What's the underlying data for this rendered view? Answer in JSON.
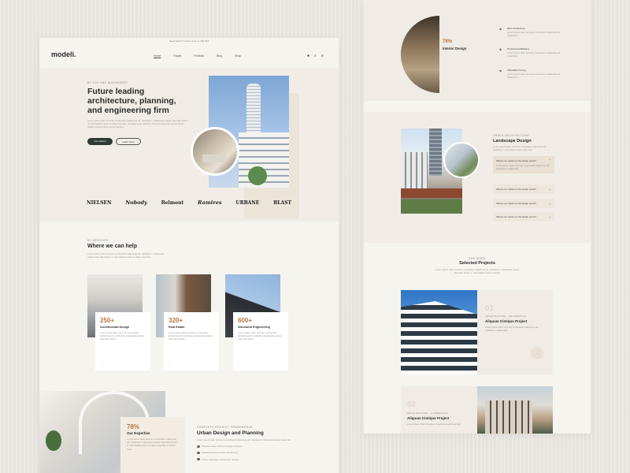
{
  "left": {
    "topbar": "Need Help? Contact us at +1 234 567",
    "logo": "modeli.",
    "nav": [
      "Home",
      "Pages",
      "Portfolio",
      "Blog",
      "Shop"
    ],
    "hero": {
      "overline": "BY YOU AND BUSINESSES",
      "title": "Future leading architecture, planning, and engineering firm",
      "desc": "Lorem ipsum dolor sit amet, consectetur adipiscing elit. Vestibulum malesuada massa vitae felis dictum ut. Sed dapibus lacus at tellus imperdiet, at aliquet nunc interdum. Praesent placerat tempus lectus. Nullam posuere lorem vel leo tempus.",
      "btn_primary": "Get started",
      "btn_secondary": "Learn more"
    },
    "brands": [
      "NIELSEN",
      "Nobody",
      "Belmont",
      "Ramires",
      "URBANE",
      "BLAST"
    ],
    "services": {
      "overline": "BY SERVICES",
      "title": "Where we can help",
      "desc": "Lorem ipsum dolor sit amet, consectetur adipiscing elit. Vestibulum malesuada massa vitae felis dictum ut. Sed dapibus lacus at tellus imperdiet.",
      "cards": [
        {
          "num": "250+",
          "name": "Architectural Design",
          "text": "Lorem ipsum dolor sit amet, consectetur adipiscing elit. Vestibulum malesuada massa vitae felis dictum.",
          "arrow": "→"
        },
        {
          "num": "320+",
          "name": "Real Estate",
          "text": "Lorem ipsum dolor sit amet, consectetur adipiscing elit. Vestibulum malesuada massa vitae felis dictum.",
          "arrow": "→"
        },
        {
          "num": "600+",
          "name": "Structural Engineering",
          "text": "Lorem ipsum dolor sit amet, consectetur adipiscing elit. Vestibulum malesuada massa vitae felis dictum.",
          "arrow": "→"
        }
      ]
    },
    "expertise": {
      "pct": "78%",
      "name": "Our Expertise",
      "text": "Lorem ipsum dolor sit amet, consectetur adipiscing elit. Vestibulum malesuada massa vitae felis dictum ut. Sed dapibus lacus at tellus imperdiet, at aliquet nunc."
    },
    "urban": {
      "overline": "COMPLETE PROJECT FRAMEWORKS",
      "title": "Urban Design and Planning",
      "desc": "Lorem ipsum dolor sit amet, consectetur adipiscing elit. Vestibulum malesuada massa vitae felis.",
      "items": [
        "Bespoke state-of-the-art design solutions",
        "Masterplanning & urban site planning",
        "Urban landscape architecture designs"
      ]
    }
  },
  "right": {
    "interior": {
      "pct": "78%",
      "name": "Interior Design"
    },
    "features": [
      {
        "title": "Best Architecture",
        "desc": "Lorem ipsum dolor sit amet, consectetur adipiscing elit. Vestibulum."
      },
      {
        "title": "Professional Builders",
        "desc": "Lorem ipsum dolor sit amet, consectetur adipiscing elit. Vestibulum."
      },
      {
        "title": "Affordable Pricing",
        "desc": "Lorem ipsum dolor sit amet, consectetur adipiscing elit. Vestibulum."
      }
    ],
    "landscape": {
      "overline": "GREEN ARCHITECTURE",
      "title": "Landscape Design",
      "desc": "Lorem ipsum dolor sit amet, consectetur adipiscing elit. Vestibulum malesuada massa vitae felis.",
      "accordion": [
        "What is our mission in the design sector?",
        "What is our mission in the design sector?",
        "What is our mission in the design sector?",
        "What is our mission in the design sector?"
      ],
      "accordion_body": "Lorem ipsum dolor sit amet, consectetur adipiscing elit. Vestibulum malesuada."
    },
    "projects": {
      "overline": "OUR WORK",
      "title": "Selected Projects",
      "desc": "Lorem ipsum dolor sit amet, consectetur adipiscing elit. Vestibulum malesuada massa vitae felis dictum ut. Sed dapibus lacus at tellus.",
      "items": [
        {
          "num": "01",
          "tag": "ARCHITECTURE · RESIDENTIAL",
          "name": "Aliquam tristique Project",
          "desc": "Lorem ipsum dolor sit amet, consectetur adipiscing elit. Vestibulum malesuada."
        },
        {
          "num": "02",
          "tag": "ARCHITECTURE · COMMERCIAL",
          "name": "Aliquam tristique Project",
          "desc": "Lorem ipsum dolor sit amet, consectetur adipiscing elit."
        }
      ],
      "arrow": "→"
    }
  }
}
